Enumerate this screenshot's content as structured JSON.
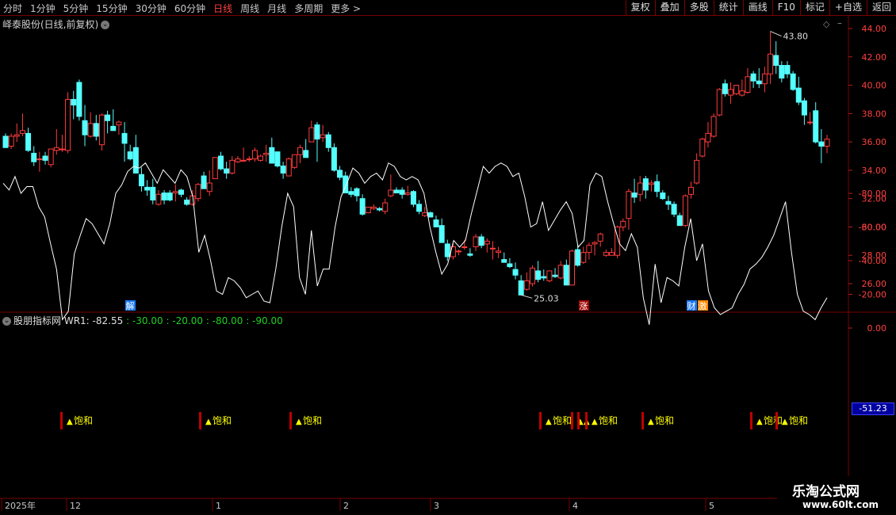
{
  "toolbar": {
    "periods": [
      "分时",
      "1分钟",
      "5分钟",
      "15分钟",
      "30分钟",
      "60分钟",
      "日线",
      "周线",
      "月线",
      "多周期",
      "更多 >"
    ],
    "active_period": "日线",
    "tools": [
      "复权",
      "叠加",
      "多股",
      "统计",
      "画线",
      "F10",
      "标记",
      "+自选",
      "返回"
    ]
  },
  "main_chart": {
    "title": "峄泰股份(日线,前复权)",
    "y_ticks": [
      "44.00",
      "42.00",
      "40.00",
      "38.00",
      "36.00",
      "34.00",
      "32.00",
      "30.00",
      "28.00",
      "26.00"
    ],
    "high_label": "43.80",
    "low_label": "25.03",
    "markers": [
      "解",
      "涨",
      "财",
      "激"
    ]
  },
  "indicator": {
    "title": "股朋指标网",
    "wr1": "WR1: -82.55",
    "levels": [
      ": -30.00",
      ": -20.00",
      ": -80.00",
      ": -90.00"
    ],
    "y_ticks": [
      "0.00",
      "-20.00",
      "-40.00",
      "-60.00",
      "-80.00"
    ],
    "current_badge": "-51.23",
    "signal_label": "饱和"
  },
  "x_axis": {
    "labels": [
      "2025年",
      "12",
      "1",
      "2",
      "3",
      "4",
      "5"
    ]
  },
  "watermark": {
    "name": "乐淘公式网",
    "url": "www.60lt.com"
  },
  "colors": {
    "up": "#ff3c3c",
    "down": "#54ffff",
    "band": "#006400",
    "signal": "#ffff00"
  },
  "chart_data": {
    "type": "candlestick",
    "ylim": [
      24,
      45
    ],
    "candles": [
      [
        36.4,
        36.6,
        35.6,
        35.6
      ],
      [
        35.7,
        36.6,
        35.5,
        36.4
      ],
      [
        36.4,
        37.3,
        36.0,
        36.5
      ],
      [
        36.6,
        38.0,
        36.4,
        36.8
      ],
      [
        36.6,
        37.0,
        35.3,
        35.4
      ],
      [
        35.2,
        35.7,
        34.3,
        34.6
      ],
      [
        34.8,
        35.3,
        33.9,
        34.8
      ],
      [
        35.0,
        35.3,
        34.4,
        34.7
      ],
      [
        34.4,
        35.5,
        34.2,
        35.5
      ],
      [
        35.4,
        36.9,
        35.1,
        35.6
      ],
      [
        35.5,
        36.5,
        35.3,
        35.5
      ],
      [
        35.4,
        39.5,
        35.2,
        39.0
      ],
      [
        39.0,
        39.6,
        37.6,
        38.6
      ],
      [
        40.2,
        40.4,
        37.5,
        37.8
      ],
      [
        37.5,
        38.6,
        35.7,
        36.5
      ],
      [
        36.4,
        38.1,
        36.3,
        37.3
      ],
      [
        37.3,
        37.9,
        36.1,
        36.4
      ],
      [
        35.8,
        38.0,
        35.4,
        37.9
      ],
      [
        37.9,
        38.2,
        36.6,
        37.5
      ],
      [
        37.1,
        38.3,
        36.8,
        36.8
      ],
      [
        37.2,
        37.5,
        36.5,
        37.4
      ],
      [
        36.6,
        37.4,
        34.6,
        35.9
      ],
      [
        35.3,
        35.8,
        34.7,
        34.8
      ],
      [
        35.6,
        36.5,
        33.8,
        33.8
      ],
      [
        33.7,
        34.2,
        32.5,
        32.9
      ],
      [
        32.8,
        33.3,
        32.2,
        32.6
      ],
      [
        32.8,
        33.4,
        31.6,
        31.9
      ],
      [
        31.6,
        32.6,
        31.5,
        32.3
      ],
      [
        32.4,
        32.6,
        31.6,
        31.9
      ],
      [
        32.4,
        32.6,
        31.8,
        31.9
      ],
      [
        32.4,
        33.0,
        31.8,
        32.5
      ],
      [
        32.6,
        32.7,
        32.1,
        32.3
      ],
      [
        31.9,
        32.1,
        31.5,
        31.6
      ],
      [
        31.6,
        32.6,
        31.5,
        32.2
      ],
      [
        32.0,
        33.1,
        31.8,
        33.0
      ],
      [
        33.6,
        33.9,
        32.7,
        32.7
      ],
      [
        32.5,
        34.0,
        32.2,
        33.1
      ],
      [
        33.4,
        34.9,
        33.4,
        34.9
      ],
      [
        35.0,
        35.3,
        34.0,
        34.1
      ],
      [
        34.1,
        34.6,
        33.4,
        33.8
      ],
      [
        33.8,
        35.0,
        33.7,
        34.7
      ],
      [
        34.6,
        35.0,
        34.5,
        34.8
      ],
      [
        34.7,
        35.6,
        34.6,
        34.7
      ],
      [
        34.8,
        35.0,
        34.6,
        34.8
      ],
      [
        34.8,
        35.6,
        34.6,
        35.4
      ],
      [
        34.7,
        35.1,
        34.6,
        35.0
      ],
      [
        35.1,
        35.8,
        34.6,
        35.2
      ],
      [
        35.6,
        36.3,
        34.7,
        34.5
      ],
      [
        35.3,
        35.3,
        34.2,
        34.3
      ],
      [
        34.3,
        34.6,
        33.4,
        33.8
      ],
      [
        33.6,
        34.9,
        33.6,
        34.8
      ],
      [
        34.2,
        35.1,
        34.1,
        35.1
      ],
      [
        35.1,
        35.8,
        34.5,
        35.6
      ],
      [
        35.4,
        36.2,
        34.9,
        34.9
      ],
      [
        36.0,
        37.5,
        36.0,
        37.0
      ],
      [
        37.2,
        37.4,
        34.6,
        36.2
      ],
      [
        36.3,
        37.2,
        36.0,
        36.5
      ],
      [
        36.5,
        36.7,
        35.3,
        35.6
      ],
      [
        35.6,
        35.9,
        33.9,
        34.0
      ],
      [
        34.0,
        34.3,
        33.3,
        33.5
      ],
      [
        33.6,
        33.9,
        32.4,
        32.4
      ],
      [
        32.5,
        32.8,
        32.1,
        32.3
      ],
      [
        32.7,
        32.8,
        31.8,
        32.2
      ],
      [
        32.0,
        32.3,
        30.8,
        30.9
      ],
      [
        31.0,
        31.3,
        31.2,
        31.4
      ],
      [
        31.3,
        31.6,
        31.2,
        31.4
      ],
      [
        31.3,
        31.4,
        31.1,
        31.2
      ],
      [
        31.1,
        32.0,
        30.9,
        31.7
      ],
      [
        32.2,
        33.7,
        32.1,
        32.6
      ],
      [
        32.6,
        32.8,
        32.5,
        32.4
      ],
      [
        32.6,
        32.8,
        32.0,
        32.3
      ],
      [
        32.3,
        32.9,
        32.2,
        32.4
      ],
      [
        32.5,
        32.6,
        31.4,
        31.6
      ],
      [
        31.6,
        31.9,
        30.9,
        31.1
      ],
      [
        30.8,
        31.4,
        30.7,
        31.0
      ],
      [
        31.0,
        31.1,
        30.7,
        30.7
      ],
      [
        30.5,
        30.8,
        30.0,
        30.0
      ],
      [
        30.1,
        30.6,
        28.9,
        28.9
      ],
      [
        28.8,
        29.1,
        27.6,
        27.9
      ],
      [
        27.9,
        28.9,
        27.7,
        28.6
      ],
      [
        28.3,
        28.4,
        28.0,
        28.3
      ],
      [
        28.6,
        29.1,
        28.4,
        28.6
      ],
      [
        28.1,
        28.5,
        27.9,
        28.0
      ],
      [
        28.6,
        29.5,
        28.3,
        29.3
      ],
      [
        29.3,
        29.5,
        28.5,
        28.7
      ],
      [
        28.8,
        29.2,
        28.2,
        29.0
      ],
      [
        28.5,
        29.0,
        27.7,
        28.5
      ],
      [
        28.2,
        28.6,
        27.8,
        28.3
      ],
      [
        27.7,
        28.2,
        27.5,
        27.5
      ],
      [
        27.4,
        27.8,
        27.1,
        27.2
      ],
      [
        27.0,
        27.5,
        26.3,
        26.6
      ],
      [
        26.2,
        26.6,
        25.2,
        25.2
      ],
      [
        25.6,
        26.8,
        25.5,
        26.2
      ],
      [
        26.0,
        27.3,
        25.8,
        27.1
      ],
      [
        26.9,
        27.6,
        26.1,
        26.3
      ],
      [
        26.5,
        27.0,
        26.2,
        26.4
      ],
      [
        26.2,
        26.9,
        26.1,
        26.9
      ],
      [
        26.6,
        27.1,
        26.4,
        26.5
      ],
      [
        26.4,
        27.6,
        26.3,
        27.3
      ],
      [
        27.3,
        27.7,
        25.9,
        25.9
      ],
      [
        25.9,
        28.4,
        25.9,
        28.3
      ],
      [
        28.4,
        28.8,
        27.2,
        27.3
      ],
      [
        27.5,
        28.6,
        27.4,
        28.2
      ],
      [
        28.2,
        28.9,
        27.7,
        28.7
      ],
      [
        28.8,
        29.0,
        28.0,
        28.9
      ],
      [
        29.0,
        29.6,
        28.6,
        29.5
      ],
      [
        28.0,
        28.4,
        27.9,
        28.2
      ],
      [
        28.0,
        28.5,
        28.0,
        28.2
      ],
      [
        28.0,
        30.1,
        27.8,
        30.0
      ],
      [
        30.0,
        30.6,
        29.7,
        30.4
      ],
      [
        30.6,
        32.7,
        29.8,
        32.5
      ],
      [
        32.4,
        33.4,
        31.7,
        32.1
      ],
      [
        32.3,
        33.6,
        31.8,
        33.1
      ],
      [
        33.4,
        33.6,
        32.0,
        32.6
      ],
      [
        33.0,
        33.3,
        32.5,
        33.1
      ],
      [
        33.2,
        33.7,
        32.1,
        32.5
      ],
      [
        32.4,
        32.6,
        31.9,
        32.0
      ],
      [
        31.8,
        32.2,
        31.2,
        31.6
      ],
      [
        31.6,
        31.8,
        30.7,
        30.9
      ],
      [
        30.8,
        31.0,
        30.1,
        30.1
      ],
      [
        30.1,
        32.3,
        30.0,
        32.2
      ],
      [
        32.3,
        33.2,
        32.0,
        32.8
      ],
      [
        33.1,
        35.2,
        33.0,
        34.7
      ],
      [
        35.0,
        36.3,
        34.9,
        36.2
      ],
      [
        36.0,
        37.4,
        35.6,
        36.6
      ],
      [
        36.4,
        38.0,
        36.3,
        37.8
      ],
      [
        37.9,
        39.8,
        37.8,
        39.7
      ],
      [
        40.1,
        40.4,
        39.2,
        39.4
      ],
      [
        39.3,
        40.2,
        38.7,
        39.7
      ],
      [
        39.4,
        40.0,
        39.3,
        40.0
      ],
      [
        39.3,
        40.4,
        39.2,
        39.6
      ],
      [
        39.5,
        41.2,
        39.4,
        40.6
      ],
      [
        40.8,
        41.0,
        39.8,
        40.3
      ],
      [
        40.3,
        41.2,
        39.8,
        40.1
      ],
      [
        40.1,
        41.3,
        39.5,
        40.8
      ],
      [
        40.8,
        43.8,
        40.1,
        42.2
      ],
      [
        42.1,
        43.1,
        40.8,
        41.4
      ],
      [
        41.4,
        41.7,
        40.2,
        40.5
      ],
      [
        41.4,
        41.7,
        40.5,
        40.8
      ],
      [
        40.8,
        41.0,
        39.6,
        39.7
      ],
      [
        39.8,
        40.6,
        38.6,
        38.8
      ],
      [
        38.9,
        39.1,
        37.2,
        37.9
      ],
      [
        37.4,
        38.1,
        37.2,
        37.4
      ],
      [
        38.2,
        38.8,
        35.9,
        36.0
      ],
      [
        36.0,
        36.9,
        34.5,
        35.7
      ],
      [
        35.7,
        36.5,
        35.2,
        36.2
      ]
    ],
    "wr_series": [
      -86,
      -82,
      -90,
      -80,
      -84,
      -84,
      -72,
      -66,
      -50,
      -35,
      -5,
      -10,
      -44,
      -55,
      -65,
      -62,
      -56,
      -50,
      -62,
      -80,
      -85,
      -93,
      -96,
      -95,
      -98,
      -92,
      -86,
      -94,
      -90,
      -86,
      -94,
      -90,
      -78,
      -45,
      -55,
      -40,
      -22,
      -20,
      -30,
      -28,
      -24,
      -18,
      -20,
      -22,
      -16,
      -15,
      -35,
      -60,
      -80,
      -72,
      -30,
      -20,
      -58,
      -25,
      -35,
      -35,
      -60,
      -78,
      -86,
      -95,
      -92,
      -86,
      -90,
      -92,
      -88,
      -98,
      -96,
      -90,
      -88,
      -90,
      -88,
      -80,
      -60,
      -45,
      -32,
      -38,
      -52,
      -48,
      -52,
      -68,
      -82,
      -96,
      -92,
      -96,
      -98,
      -96,
      -90,
      -92,
      -78,
      -60,
      -62,
      -75,
      -58,
      -64,
      -70,
      -75,
      -68,
      -48,
      -52,
      -85,
      -92,
      -90,
      -75,
      -62,
      -50,
      -46,
      -56,
      -48,
      -18,
      -2,
      -38,
      -15,
      -30,
      -28,
      -25,
      -48,
      -65,
      -40,
      -50,
      -22,
      -12,
      -8,
      -10,
      -12,
      -20,
      -26,
      -35,
      -38,
      -42,
      -48,
      -55,
      -65,
      -75,
      -45,
      -20,
      -10,
      -8,
      -5,
      -12,
      -18
    ],
    "band_upper": [
      -20,
      -30
    ],
    "band_lower": [
      -80,
      -90
    ]
  }
}
